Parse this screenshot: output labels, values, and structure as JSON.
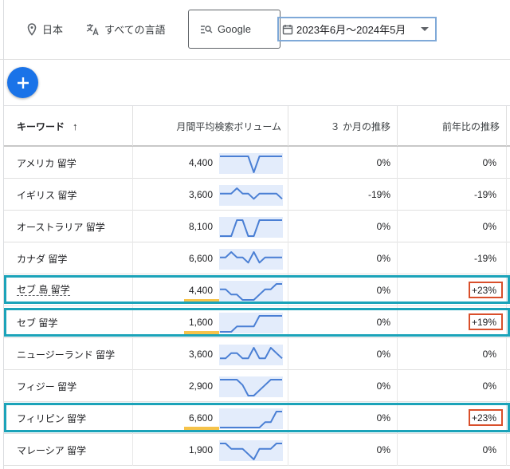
{
  "toolbar": {
    "location": "日本",
    "language": "すべての言語",
    "network": "Google",
    "date_range": "2023年6月〜2024年5月"
  },
  "table": {
    "headers": {
      "keyword": "キーワード",
      "sort_arrow": "↑",
      "volume": "月間平均検索ボリューム",
      "three_month": "３ か月の推移",
      "yoy": "前年比の推移"
    },
    "rows": [
      {
        "keyword": "アメリカ 留学",
        "volume": "4,400",
        "three_month": "0%",
        "yoy": "0%",
        "trend": [
          4,
          4,
          4,
          4,
          4,
          4,
          1,
          4,
          4,
          4,
          4,
          4
        ]
      },
      {
        "keyword": "イギリス 留学",
        "volume": "3,600",
        "three_month": "-19%",
        "yoy": "-19%",
        "trend": [
          3,
          3,
          3,
          4,
          3,
          3,
          2,
          3,
          3,
          3,
          3,
          2
        ]
      },
      {
        "keyword": "オーストラリア 留学",
        "volume": "8,100",
        "three_month": "0%",
        "yoy": "0%",
        "trend": [
          1,
          1,
          1,
          4,
          4,
          1,
          1,
          4,
          4,
          4,
          4,
          4
        ]
      },
      {
        "keyword": "カナダ 留学",
        "volume": "6,600",
        "three_month": "0%",
        "yoy": "-19%",
        "trend": [
          3,
          3,
          4,
          3,
          3,
          2,
          4,
          2,
          3,
          3,
          3,
          3
        ]
      },
      {
        "keyword": "セブ 島 留学",
        "volume": "4,400",
        "three_month": "0%",
        "yoy": "+23%",
        "trend": [
          3,
          3,
          2,
          2,
          1,
          1,
          1,
          2,
          3,
          3,
          4,
          4
        ]
      },
      {
        "keyword": "セブ 留学",
        "volume": "1,600",
        "three_month": "0%",
        "yoy": "+19%",
        "trend": [
          1,
          1,
          1,
          2,
          2,
          2,
          2,
          4,
          4,
          4,
          4,
          4
        ]
      },
      {
        "keyword": "ニュージーランド 留学",
        "volume": "3,600",
        "three_month": "0%",
        "yoy": "0%",
        "trend": [
          2,
          2,
          3,
          3,
          2,
          2,
          4,
          2,
          2,
          4,
          3,
          2
        ]
      },
      {
        "keyword": "フィジー 留学",
        "volume": "2,900",
        "three_month": "0%",
        "yoy": "0%",
        "trend": [
          4,
          4,
          4,
          4,
          3,
          1,
          1,
          2,
          3,
          4,
          4,
          4
        ]
      },
      {
        "keyword": "フィリピン 留学",
        "volume": "6,600",
        "three_month": "0%",
        "yoy": "+23%",
        "trend": [
          1,
          1,
          1,
          1,
          1,
          1,
          1,
          1,
          2,
          2,
          4,
          4
        ]
      },
      {
        "keyword": "マレーシア 留学",
        "volume": "1,900",
        "three_month": "0%",
        "yoy": "0%",
        "trend": [
          4,
          4,
          3,
          3,
          3,
          2,
          1,
          3,
          3,
          3,
          4,
          4
        ]
      }
    ]
  },
  "colors": {
    "accent": "#1a73e8",
    "spark_line": "#4a7fd4",
    "spark_fill": "#e3ecfb",
    "highlight_box": "#1ba3b9",
    "red_box": "#d94f2b",
    "underline": "#f6c34a"
  }
}
